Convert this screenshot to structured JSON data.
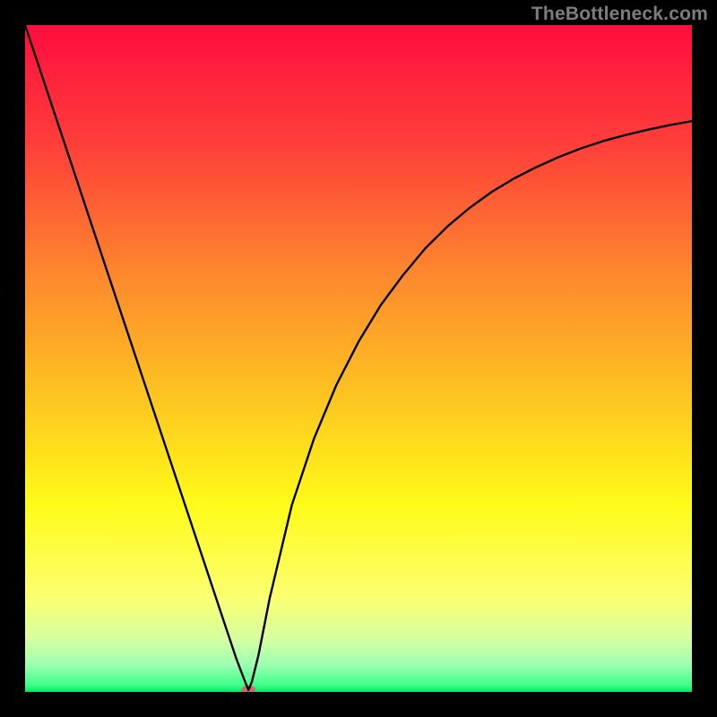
{
  "watermark": "TheBottleneck.com",
  "chart_data": {
    "type": "line",
    "title": "",
    "xlabel": "",
    "ylabel": "",
    "xlim": [
      0,
      100
    ],
    "ylim": [
      0,
      100
    ],
    "grid": false,
    "legend": false,
    "background_gradient": {
      "stops": [
        {
          "pos": 0.0,
          "color": "#ff0d3e"
        },
        {
          "pos": 0.18,
          "color": "#ff3f3a"
        },
        {
          "pos": 0.38,
          "color": "#fe8a2d"
        },
        {
          "pos": 0.55,
          "color": "#fec221"
        },
        {
          "pos": 0.72,
          "color": "#fffb19"
        },
        {
          "pos": 0.86,
          "color": "#fbff72"
        },
        {
          "pos": 0.92,
          "color": "#d6ffa0"
        },
        {
          "pos": 0.96,
          "color": "#9cffb2"
        },
        {
          "pos": 0.99,
          "color": "#3eff8b"
        },
        {
          "pos": 1.0,
          "color": "#02e765"
        }
      ]
    },
    "series": [
      {
        "name": "bottleneck-curve",
        "color": "#000000",
        "x": [
          0.0,
          3.33,
          6.67,
          10.0,
          13.33,
          16.67,
          20.0,
          23.33,
          26.67,
          30.0,
          31.67,
          33.0,
          33.5,
          34.0,
          35.0,
          36.67,
          40.0,
          43.33,
          46.67,
          50.0,
          53.33,
          56.67,
          60.0,
          63.33,
          66.67,
          70.0,
          73.33,
          76.67,
          80.0,
          83.33,
          86.67,
          90.0,
          93.33,
          96.67,
          100.0
        ],
        "y": [
          100.0,
          90.0,
          80.0,
          70.0,
          60.0,
          50.0,
          40.0,
          30.0,
          20.0,
          10.0,
          5.0,
          1.5,
          0.3,
          1.5,
          5.5,
          14.0,
          28.0,
          38.0,
          46.0,
          52.5,
          58.0,
          62.5,
          66.5,
          69.8,
          72.6,
          75.0,
          77.0,
          78.7,
          80.2,
          81.5,
          82.6,
          83.5,
          84.3,
          85.0,
          85.6
        ]
      }
    ],
    "marker": {
      "name": "optimal-point",
      "x": 33.5,
      "y": 0.3,
      "color": "#cf6b6b",
      "rx": 8,
      "ry": 5
    }
  }
}
